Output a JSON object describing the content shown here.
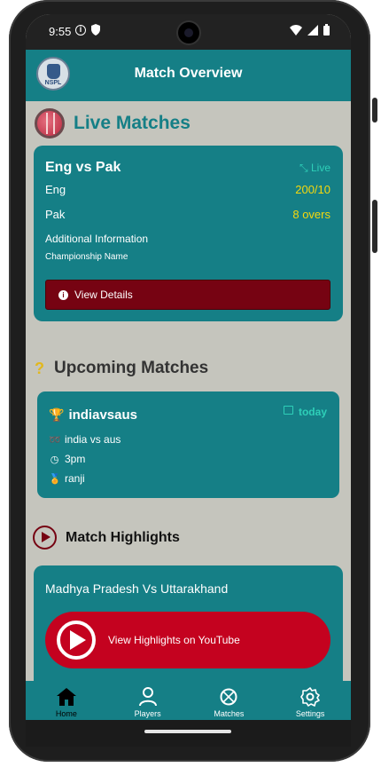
{
  "status_bar": {
    "time": "9:55"
  },
  "app_bar": {
    "title": "Match Overview",
    "logo_text": "NSPL"
  },
  "live": {
    "heading": "Live Matches",
    "card": {
      "title": "Eng vs Pak",
      "status": "Live",
      "team1": "Eng",
      "team1_score": "200/10",
      "team2": "Pak",
      "team2_score": "8 overs",
      "info_label": "Additional Information",
      "info_sub": "Championship Name",
      "button_label": "View Details"
    }
  },
  "upcoming": {
    "heading": "Upcoming Matches",
    "card": {
      "title": "indiavsaus",
      "date": "today",
      "teams": "india vs aus",
      "time": "3pm",
      "tournament": "ranji"
    }
  },
  "highlights": {
    "heading": "Match Highlights",
    "card": {
      "title": "Madhya Pradesh Vs Uttarakhand",
      "button_label": "View Highlights on YouTube"
    }
  },
  "bottom_nav": {
    "items": [
      {
        "label": "Home",
        "icon": "home-icon",
        "active": true
      },
      {
        "label": "Players",
        "icon": "person-icon",
        "active": false
      },
      {
        "label": "Matches",
        "icon": "ball-icon",
        "active": false
      },
      {
        "label": "Settings",
        "icon": "gear-icon",
        "active": false
      }
    ]
  },
  "colors": {
    "teal": "#157f86",
    "accent_cyan": "#2ecfb8",
    "score_yellow": "#f6d80c",
    "dark_red": "#760312",
    "youtube_red": "#c4021f",
    "background": "#c5c5bd"
  }
}
